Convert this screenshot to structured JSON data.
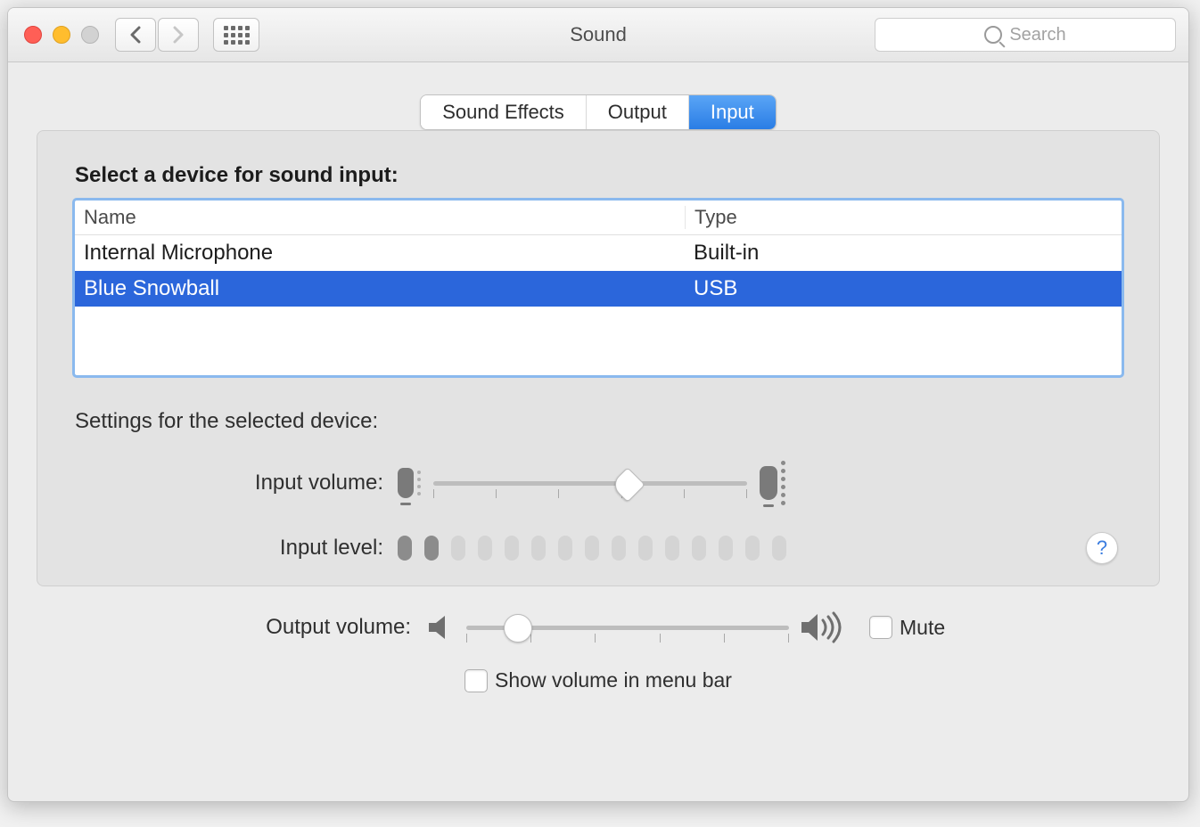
{
  "title": "Sound",
  "search": {
    "placeholder": "Search"
  },
  "tabs": {
    "sound_effects": "Sound Effects",
    "output": "Output",
    "input": "Input"
  },
  "section": {
    "select_device_heading": "Select a device for sound input:",
    "settings_heading": "Settings for the selected device:",
    "columns": {
      "name": "Name",
      "type": "Type"
    },
    "devices": [
      {
        "name": "Internal Microphone",
        "type": "Built-in",
        "selected": false
      },
      {
        "name": "Blue Snowball",
        "type": "USB",
        "selected": true
      }
    ],
    "labels": {
      "input_volume": "Input volume:",
      "input_level": "Input level:"
    },
    "input_volume_percent": 62,
    "input_level_active_bars": 2,
    "input_level_total_bars": 15
  },
  "footer": {
    "output_volume_label": "Output volume:",
    "output_volume_percent": 16,
    "mute_label": "Mute",
    "mute_checked": false,
    "menubar_label": "Show volume in menu bar",
    "menubar_checked": false
  },
  "help_label": "?"
}
